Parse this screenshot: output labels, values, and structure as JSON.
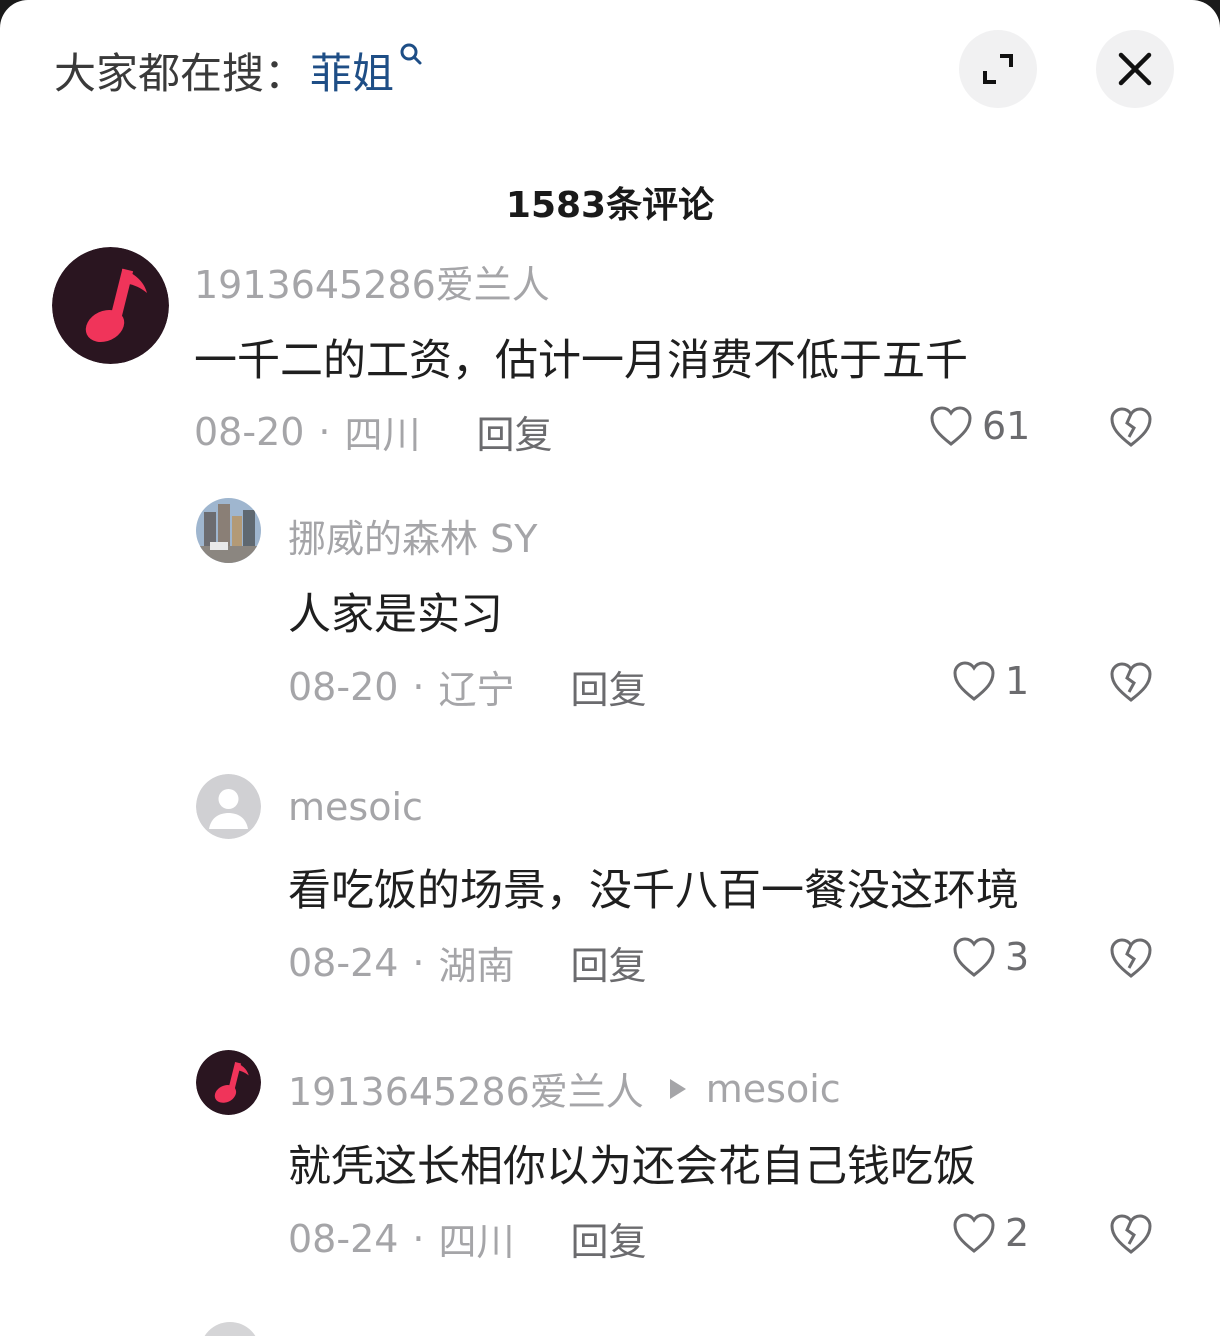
{
  "header": {
    "search_prefix": "大家都在搜：",
    "search_term": "菲姐",
    "expand_button": "expand-icon",
    "close_button": "close-icon"
  },
  "comment_count": "1583条评论",
  "comments": [
    {
      "username": "1913645286爱兰人",
      "text": "一千二的工资，估计一月消费不低于五千",
      "date": "08-20",
      "location": "四川",
      "reply": "回复",
      "likes": "61",
      "avatar": "music-note-avatar"
    },
    {
      "username": "挪威的森林 SY",
      "text": "人家是实习",
      "date": "08-20",
      "location": "辽宁",
      "reply": "回复",
      "likes": "1",
      "avatar": "city-photo-avatar"
    },
    {
      "username": "mesoic",
      "text": "看吃饭的场景，没千八百一餐没这环境",
      "date": "08-24",
      "location": "湖南",
      "reply": "回复",
      "likes": "3",
      "avatar": "default-user-avatar"
    },
    {
      "username": "1913645286爱兰人",
      "reply_to": "mesoic",
      "text": "就凭这长相你以为还会花自己钱吃饭",
      "date": "08-24",
      "location": "四川",
      "reply": "回复",
      "likes": "2",
      "avatar": "music-note-avatar"
    }
  ],
  "separator": "·",
  "colors": {
    "link": "#1e4e86",
    "muted": "#a5a5a8",
    "text": "#1f1f1f",
    "avatar_pink": "#f0345a"
  }
}
